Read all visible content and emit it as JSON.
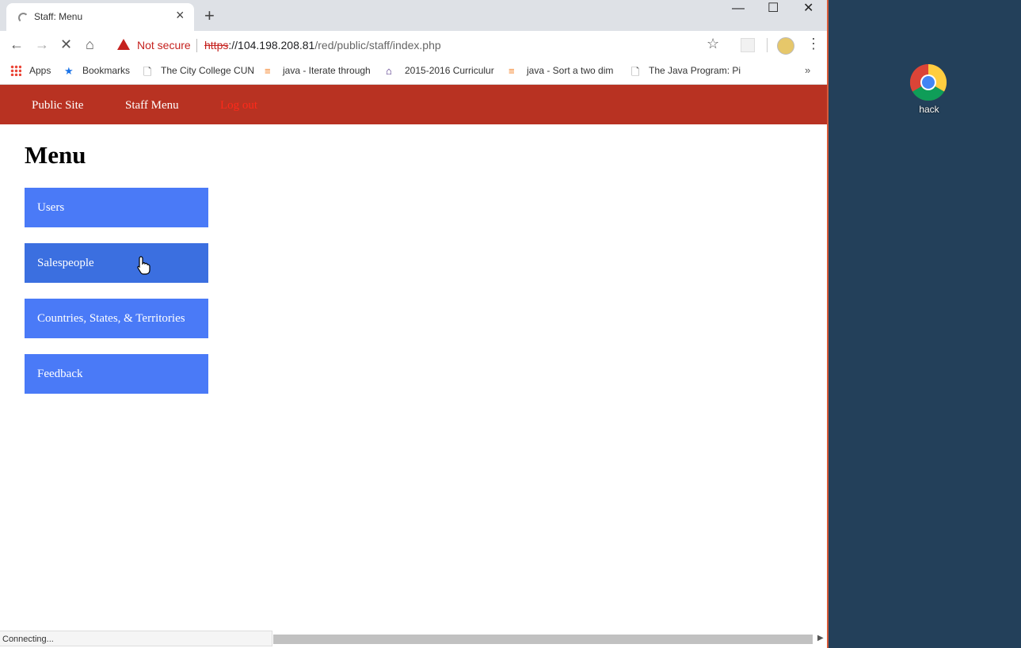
{
  "browser": {
    "tab_title": "Staff: Menu",
    "tab_close": "×",
    "new_tab": "+",
    "window_controls": {
      "minimize": "—",
      "maximize": "☐",
      "close": "✕"
    },
    "security_label": "Not secure",
    "url": {
      "scheme": "https",
      "host": "://104.198.208.81",
      "path": "/red/public/staff/index.php"
    },
    "bookmarks": [
      {
        "label": "Apps",
        "icon": "apps-grid-icon"
      },
      {
        "label": "Bookmarks",
        "icon": "star-icon"
      },
      {
        "label": "The City College CUN",
        "icon": "page-icon"
      },
      {
        "label": "java - Iterate through",
        "icon": "stackoverflow-icon"
      },
      {
        "label": "2015-2016 Curriculur",
        "icon": "castle-icon"
      },
      {
        "label": "java - Sort a two dim",
        "icon": "stackoverflow-icon"
      },
      {
        "label": "The Java Program: Pi",
        "icon": "page-icon"
      }
    ],
    "bookmarks_more": "»",
    "status_text": "Connecting..."
  },
  "page": {
    "nav": {
      "public_site": "Public Site",
      "staff_menu": "Staff Menu",
      "logout": "Log out"
    },
    "heading": "Menu",
    "menu_items": [
      {
        "label": "Users"
      },
      {
        "label": "Salespeople"
      },
      {
        "label": "Countries, States, & Territories"
      },
      {
        "label": "Feedback"
      }
    ]
  },
  "desktop": {
    "icon_label": "hack",
    "icon": "chrome-icon"
  },
  "colors": {
    "navbar": "#b83222",
    "menu_button": "#4a7af7",
    "desktop": "#23405a",
    "logout": "#ff2a1a"
  }
}
